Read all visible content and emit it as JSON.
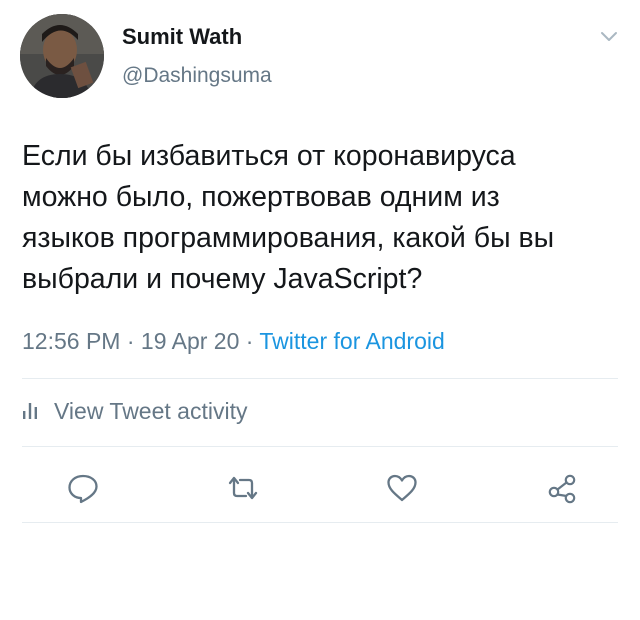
{
  "tweet": {
    "author": {
      "name": "Sumit Wath",
      "handle": "@Dashingsuma"
    },
    "text": "Если бы избавиться от коронавируса\nможно было, пожертвовав одним из\nязыков программирования, какой бы вы\nвыбрали и почему JavaScript?",
    "time": "12:56 PM",
    "date": "19 Apr 20",
    "source": "Twitter for Android",
    "separator": " · ",
    "activity_label": "View Tweet activity"
  },
  "icons": {
    "menu": "chevron-down-icon",
    "activity": "bar-chart-icon",
    "reply": "reply-icon",
    "retweet": "retweet-icon",
    "like": "heart-icon",
    "share": "share-icon"
  },
  "colors": {
    "text": "#14171a",
    "secondary": "#657786",
    "link": "#1b95e0",
    "divider": "#e6ecf0"
  }
}
